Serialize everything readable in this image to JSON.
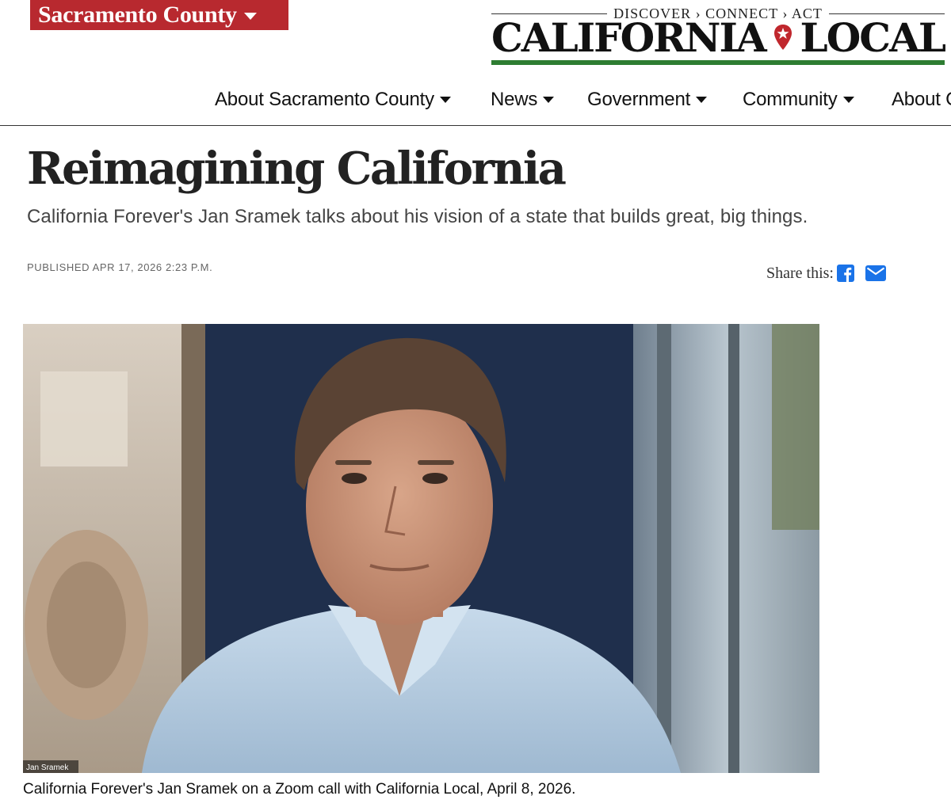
{
  "county_selector": {
    "label": "Sacramento County"
  },
  "logo": {
    "tagline": "DISCOVER › CONNECT › ACT",
    "wordmark_left": "CALIFORNIA",
    "wordmark_right": "LOCAL",
    "colors": {
      "green": "#2e7d32",
      "red": "#c0272d"
    }
  },
  "nav": {
    "items": [
      {
        "label": "About Sacramento County"
      },
      {
        "label": "News"
      },
      {
        "label": "Government"
      },
      {
        "label": "Community"
      },
      {
        "label": "About C"
      }
    ]
  },
  "article": {
    "title": "Reimagining California",
    "subtitle": "California Forever's Jan Sramek talks about his vision of a state that builds great, big things.",
    "published": "PUBLISHED APR 17, 2026 2:23 P.M.",
    "share_label": "Share this:",
    "share_icons": [
      "facebook-icon",
      "mail-icon"
    ],
    "photo_name_tag": "Jan Sramek",
    "caption": "California Forever's Jan Sramek on a Zoom call with California Local, April 8, 2026."
  },
  "colors": {
    "county_bg": "#b8292f",
    "share_blue": "#1a73e8"
  }
}
